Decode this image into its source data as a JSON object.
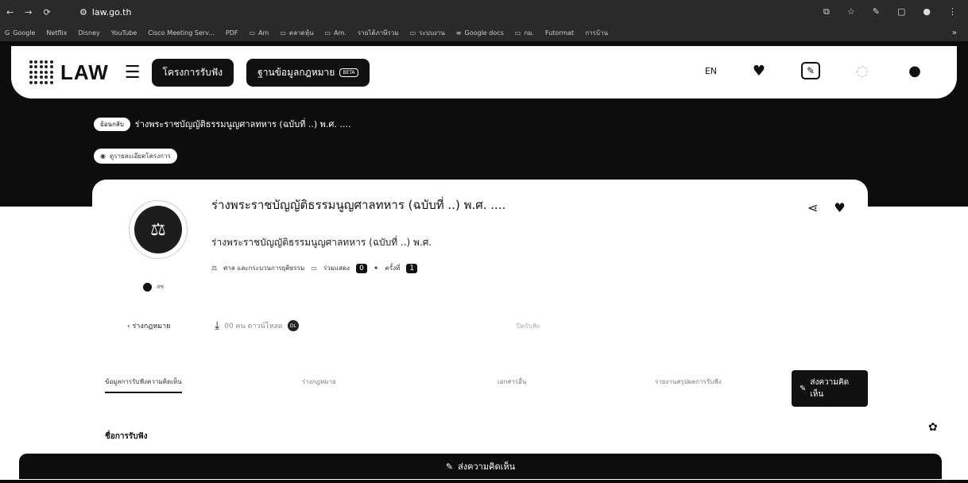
{
  "browser": {
    "url_domain": "law.go.th",
    "bookmarks": [
      "Google",
      "Netflix",
      "Disney",
      "YouTube",
      "Cisco Meeting Serv...",
      "PDF",
      "Am",
      "ตลาดหุ้น",
      "Am.",
      "รายได้ภาษีรวม",
      "ระบบงาน",
      "Google docs",
      "กม.",
      "Futormat",
      "การบ้าน"
    ],
    "more": "»"
  },
  "header": {
    "logo_text": "LAW",
    "nav_button_1": "โครงการรับฟัง",
    "nav_button_2": "ฐานข้อมูลกฎหมาย",
    "beta_label": "BETA",
    "lang": "EN"
  },
  "breadcrumb": {
    "back_label": "ย้อนกลับ",
    "title": "ร่างพระราชบัญญัติธรรมนูญศาลทหาร (ฉบับที่ ..) พ.ศ. ...."
  },
  "detail_pill": "ดูรายละเอียดโครงการ",
  "project": {
    "title": "ร่างพระราชบัญญัติธรรมนูญศาลทหาร (ฉบับที่ ..) พ.ศ. ....",
    "subtitle": "ร่างพระราชบัญญัติธรรมนูญศาลทหาร (ฉบับที่ ..) พ.ศ.",
    "category": "ศาล และกระบวนการยุติธรรม",
    "comments_label": "ร่วมแสดง",
    "comments_count": "0",
    "views_label": "ครั้งที่",
    "views_count": "1",
    "agency": "สช",
    "type": "ร่างกฎหมาย",
    "download_text": "00 คน ดาวน์โหลด",
    "download_badge": "DL",
    "date_text": "ปิดรับฟัง"
  },
  "tabs": {
    "items": [
      "ข้อมูลการรับฟังความคิดเห็น",
      "ร่างกฎหมาย",
      "เอกสารอื่น",
      "รายงานสรุปผลการรับฟัง"
    ],
    "cta": "ส่งความคิดเห็น"
  },
  "section": {
    "title": "ชื่อการรับฟัง"
  },
  "bottom_bar": {
    "label": "ส่งความคิดเห็น"
  }
}
